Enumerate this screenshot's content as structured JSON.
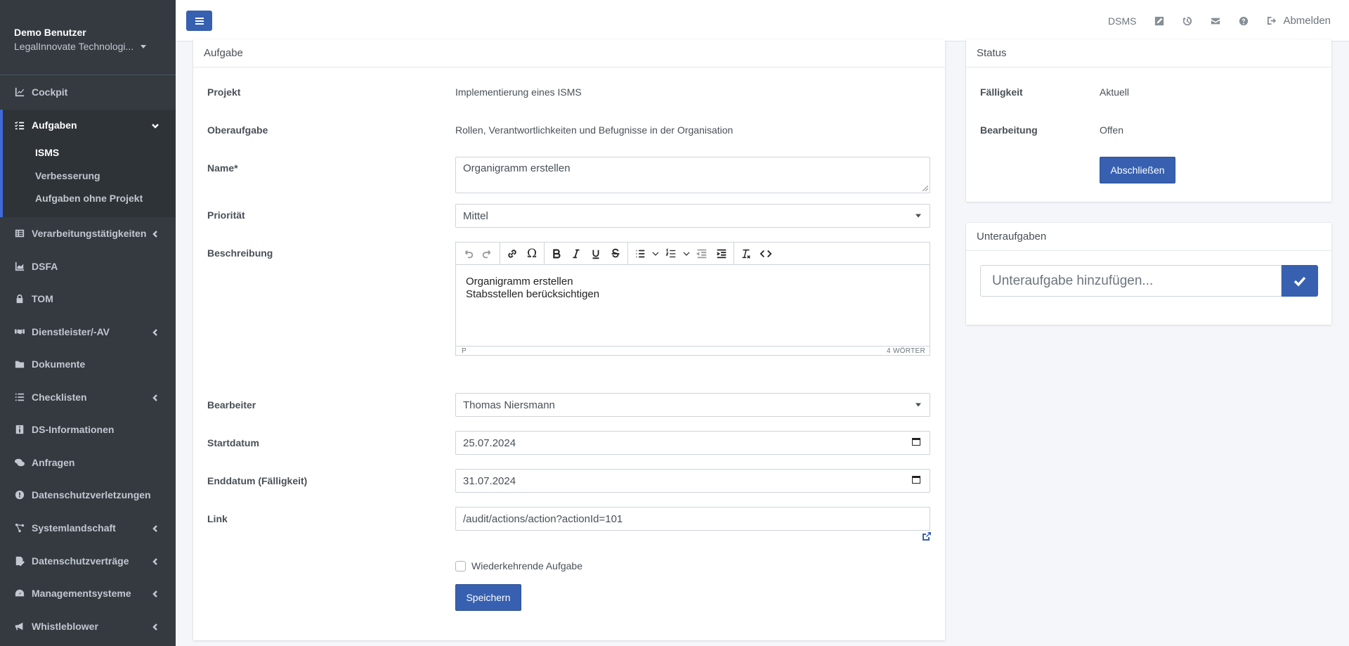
{
  "sidebar": {
    "user_name": "Demo Benutzer",
    "org_name": "LegalInnovate Technologi...",
    "items": [
      {
        "label": "Cockpit",
        "icon": "chart-line-icon"
      },
      {
        "label": "Aufgaben",
        "icon": "tasks-icon"
      },
      {
        "label": "Verarbeitungstätigkeiten",
        "icon": "list-alt-icon"
      },
      {
        "label": "DSFA",
        "icon": "chart-area-icon"
      },
      {
        "label": "TOM",
        "icon": "lock-icon"
      },
      {
        "label": "Dienstleister/-AV",
        "icon": "handshake-icon"
      },
      {
        "label": "Dokumente",
        "icon": "folder-icon"
      },
      {
        "label": "Checklisten",
        "icon": "list-icon"
      },
      {
        "label": "DS-Informationen",
        "icon": "info-icon"
      },
      {
        "label": "Anfragen",
        "icon": "comments-icon"
      },
      {
        "label": "Datenschutzverletzungen",
        "icon": "exclamation-circle-icon"
      },
      {
        "label": "Systemlandschaft",
        "icon": "project-diagram-icon"
      },
      {
        "label": "Datenschutzverträge",
        "icon": "file-signature-icon"
      },
      {
        "label": "Managementsysteme",
        "icon": "tachometer-icon"
      },
      {
        "label": "Whistleblower",
        "icon": "bullhorn-icon"
      }
    ],
    "subitems": [
      "ISMS",
      "Verbesserung",
      "Aufgaben ohne Projekt"
    ]
  },
  "topbar": {
    "dsms": "DSMS",
    "logout": "Abmelden"
  },
  "task": {
    "header": "Aufgabe",
    "project_label": "Projekt",
    "project_value": "Implementierung eines ISMS",
    "parent_label": "Oberaufgabe",
    "parent_value": "Rollen, Verantwortlichkeiten und Befugnisse in der Organisation",
    "name_label": "Name*",
    "name_value": "Organigramm erstellen",
    "priority_label": "Priorität",
    "priority_value": "Mittel",
    "description_label": "Beschreibung",
    "description_line1": "Organigramm erstellen",
    "description_line2": "Stabsstellen berücksichtigen",
    "editor_path": "P",
    "editor_wordcount": "4 WÖRTER",
    "assignee_label": "Bearbeiter",
    "assignee_value": "Thomas Niersmann",
    "start_label": "Startdatum",
    "start_value": "25.07.2024",
    "end_label": "Enddatum (Fälligkeit)",
    "end_value": "31.07.2024",
    "link_label": "Link",
    "link_value": "/audit/actions/action?actionId=101",
    "recurring_label": "Wiederkehrende Aufgabe",
    "save_label": "Speichern"
  },
  "status": {
    "header": "Status",
    "due_label": "Fälligkeit",
    "due_value": "Aktuell",
    "processing_label": "Bearbeitung",
    "processing_value": "Offen",
    "complete_label": "Abschließen"
  },
  "subtasks": {
    "header": "Unteraufgaben",
    "placeholder": "Unteraufgabe hinzufügen..."
  },
  "colors": {
    "sidebar_bg": "#343a40",
    "primary": "#3760b0",
    "page_bg": "#f4f6f9"
  }
}
